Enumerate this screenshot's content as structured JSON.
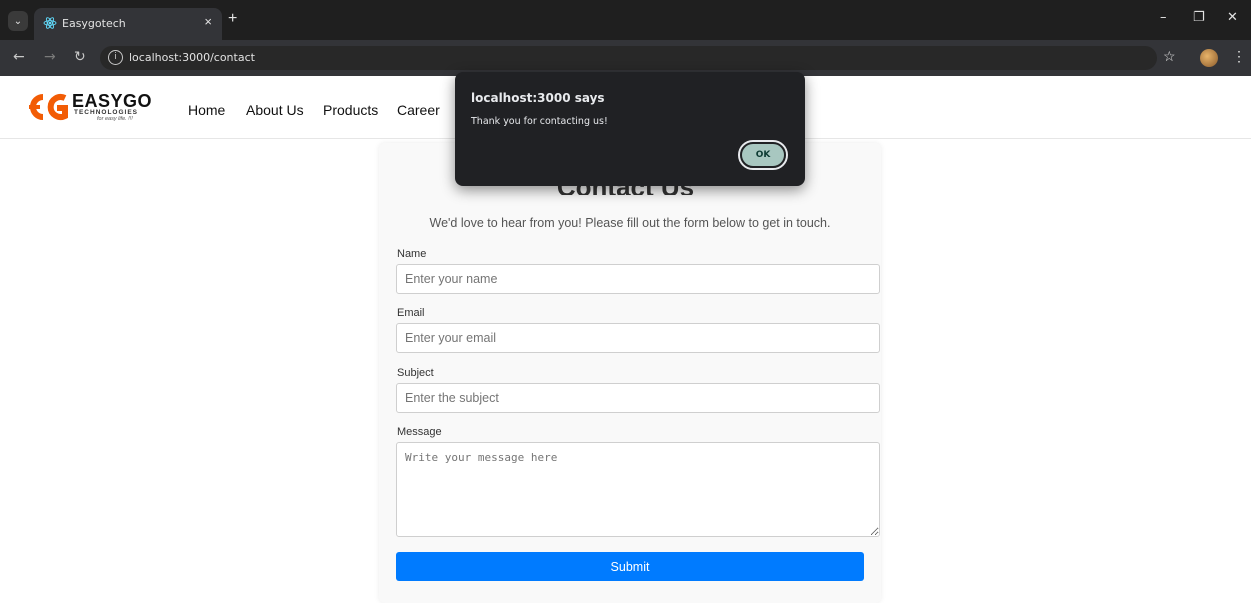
{
  "browser": {
    "tab_title": "Easygotech",
    "tab_close": "×",
    "new_tab": "+",
    "url": "localhost:3000/contact",
    "info_glyph": "i"
  },
  "site": {
    "logo_name": "EASYGO",
    "logo_sub": "TECHNOLOGIES",
    "logo_tag": "for easy life. !!!",
    "nav": [
      "Home",
      "About Us",
      "Products",
      "Career"
    ]
  },
  "contact": {
    "heading": "Contact Us",
    "intro": "We'd love to hear from you! Please fill out the form below to get in touch.",
    "name_label": "Name",
    "name_placeholder": "Enter your name",
    "email_label": "Email",
    "email_placeholder": "Enter your email",
    "subject_label": "Subject",
    "subject_placeholder": "Enter the subject",
    "message_label": "Message",
    "message_placeholder": "Write your message here",
    "submit_label": "Submit"
  },
  "dialog": {
    "title": "localhost:3000 says",
    "message": "Thank you for contacting us!",
    "ok_label": "OK"
  },
  "colors": {
    "accent": "#007bff",
    "logo_orange": "#f25c05",
    "dialog_bg": "#202124"
  },
  "icons": [
    "tab-list-icon",
    "react-favicon-icon",
    "back-arrow-icon",
    "forward-arrow-icon",
    "reload-icon",
    "site-info-icon",
    "bookmark-star-icon",
    "profile-avatar-icon",
    "browser-menu-icon",
    "minimize-icon",
    "restore-icon",
    "close-window-icon"
  ]
}
